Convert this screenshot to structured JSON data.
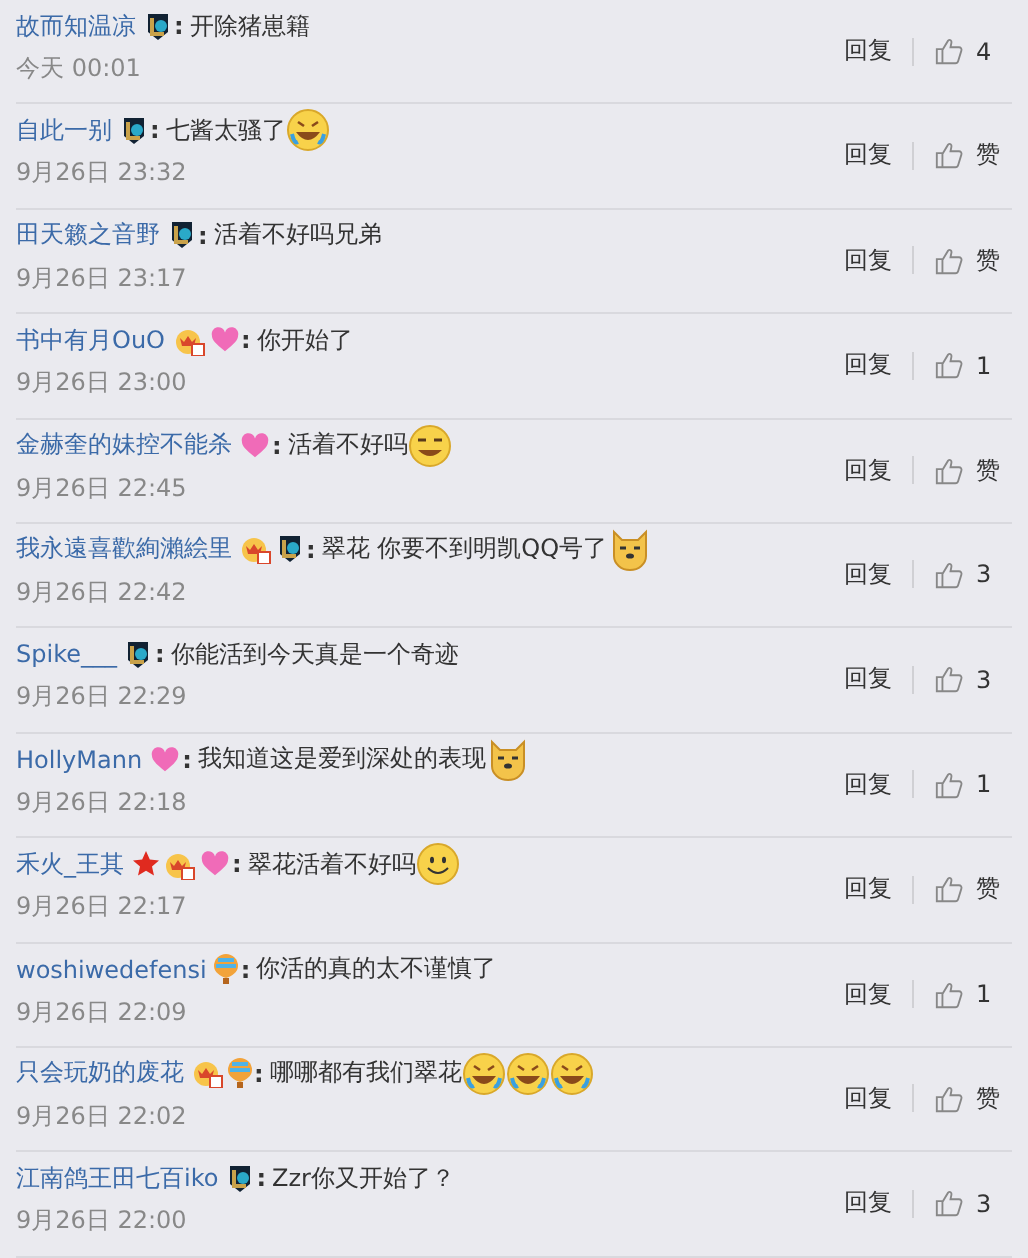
{
  "comments": [
    {
      "user": "故而知温凉",
      "badges": [
        {
          "kind": "lol"
        }
      ],
      "colon": ":",
      "text": "开除猪崽籍",
      "time": "今天 00:01",
      "reply": "回复",
      "likes": "4"
    },
    {
      "user": "自此一别",
      "badges": [
        {
          "kind": "lol"
        }
      ],
      "colon": ":",
      "text": "七酱太骚了",
      "emojis": [
        {
          "kind": "cry-laugh"
        }
      ],
      "time": "9月26日 23:32",
      "reply": "回复",
      "likes": "赞"
    },
    {
      "user": "田天籁之音野",
      "badges": [
        {
          "kind": "lol"
        }
      ],
      "colon": ":",
      "text": "活着不好吗兄弟",
      "time": "9月26日 23:17",
      "reply": "回复",
      "likes": "赞"
    },
    {
      "user": "书中有月OuO",
      "badges": [
        {
          "kind": "crown"
        },
        {
          "kind": "heart"
        }
      ],
      "colon": ":",
      "text": "你开始了",
      "time": "9月26日 23:00",
      "reply": "回复",
      "likes": "1"
    },
    {
      "user": "金赫奎的妹控不能杀",
      "badges": [
        {
          "kind": "heart"
        }
      ],
      "colon": ":",
      "text": "活着不好吗",
      "emojis": [
        {
          "kind": "grin"
        }
      ],
      "time": "9月26日 22:45",
      "reply": "回复",
      "likes": "赞"
    },
    {
      "user": "我永遠喜歡絢瀨絵里",
      "badges": [
        {
          "kind": "crown"
        },
        {
          "kind": "lol"
        }
      ],
      "colon": ":",
      "text": "翠花 你要不到明凯QQ号了",
      "emojis": [
        {
          "kind": "dog"
        }
      ],
      "time": "9月26日 22:42",
      "reply": "回复",
      "likes": "3"
    },
    {
      "user": "Spike___",
      "badges": [
        {
          "kind": "lol"
        }
      ],
      "colon": ":",
      "text": "你能活到今天真是一个奇迹",
      "time": "9月26日 22:29",
      "reply": "回复",
      "likes": "3"
    },
    {
      "user": "HollyMann",
      "badges": [
        {
          "kind": "heart"
        }
      ],
      "colon": ":",
      "text": "我知道这是爱到深处的表现",
      "emojis": [
        {
          "kind": "dog"
        }
      ],
      "time": "9月26日 22:18",
      "reply": "回复",
      "likes": "1"
    },
    {
      "user": "禾火_王其",
      "badges": [
        {
          "kind": "star"
        },
        {
          "kind": "crown"
        },
        {
          "kind": "heart"
        }
      ],
      "colon": ":",
      "text": "翠花活着不好吗",
      "emojis": [
        {
          "kind": "smile"
        }
      ],
      "time": "9月26日 22:17",
      "reply": "回复",
      "likes": "赞"
    },
    {
      "user": "woshiwedefensi",
      "badges": [
        {
          "kind": "balloon"
        }
      ],
      "colon": ":",
      "text": "你活的真的太不谨慎了",
      "time": "9月26日 22:09",
      "reply": "回复",
      "likes": "1"
    },
    {
      "user": "只会玩奶的废花",
      "badges": [
        {
          "kind": "crown"
        },
        {
          "kind": "balloon"
        }
      ],
      "colon": ":",
      "text": "哪哪都有我们翠花",
      "emojis": [
        {
          "kind": "cry-laugh"
        },
        {
          "kind": "cry-laugh"
        },
        {
          "kind": "cry-laugh"
        }
      ],
      "time": "9月26日 22:02",
      "reply": "回复",
      "likes": "赞"
    },
    {
      "user": "江南鸽王田七百iko",
      "badges": [
        {
          "kind": "lol"
        }
      ],
      "colon": ":",
      "text": "Zzr你又开始了？",
      "time": "9月26日 22:00",
      "reply": "回复",
      "likes": "3"
    }
  ]
}
